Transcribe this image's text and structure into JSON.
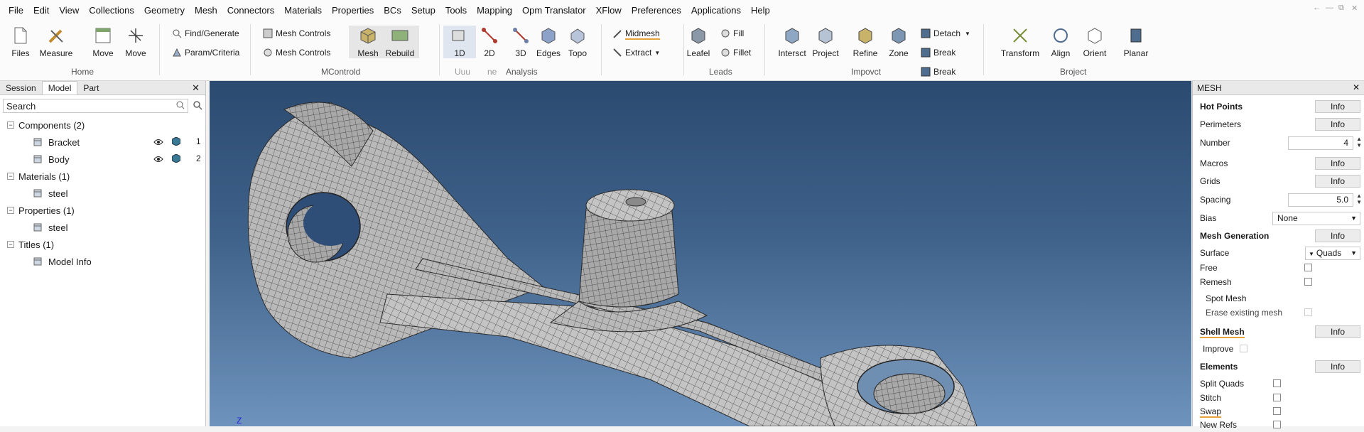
{
  "menu": [
    "File",
    "Edit",
    "View",
    "Collections",
    "Geometry",
    "Mesh",
    "Connectors",
    "Materials",
    "Properties",
    "BCs",
    "Setup",
    "Tools",
    "Mapping",
    "Opm Translator",
    "XFlow",
    "Preferences",
    "Applications",
    "Help"
  ],
  "window_controls": [
    "←",
    "—",
    "⧉",
    "✕"
  ],
  "ribbon": {
    "files": "Files",
    "measure": "Measure",
    "move1": "Move",
    "move2": "Move",
    "find_generate": "Find/Generate",
    "param_criteria": "Param/Criteria",
    "home_group": "Home",
    "mesh_controls1": "Mesh Controls",
    "mesh_controls2": "Mesh Controls",
    "mesh": "Mesh",
    "rebuild": "Rebuild",
    "mcontrol_group": "MControld",
    "b1d": "1D",
    "b2d": "2D",
    "b3d": "3D",
    "edges": "Edges",
    "topo": "Topo",
    "uuu": "Uuu",
    "ne": "ne",
    "analysis_group": "Analysis",
    "midmesh": "Midmesh",
    "extract": "Extract",
    "leafel": "Leafel",
    "fill": "Fill",
    "fillet": "Fillet",
    "leads_group": "Leads",
    "intersect": "Intersct",
    "project": "Project",
    "refine": "Refine",
    "zone": "Zone",
    "detach": "Detach",
    "break1": "Break",
    "break2": "Break",
    "improve_group": "Impovct",
    "transform": "Transform",
    "align": "Align",
    "orient": "Orient",
    "planar": "Planar",
    "project_group": "Broject"
  },
  "left_panel": {
    "tabs": [
      "Session",
      "Model",
      "Part"
    ],
    "active_tab": "Model",
    "close": "✕",
    "search_placeholder": "Search",
    "tree": [
      {
        "label": "Components (2)",
        "level": 0
      },
      {
        "label": "Bracket",
        "level": 1,
        "num": "1",
        "visible": true
      },
      {
        "label": "Body",
        "level": 1,
        "num": "2",
        "visible": true
      },
      {
        "label": "Materials (1)",
        "level": 0
      },
      {
        "label": "steel",
        "level": 1
      },
      {
        "label": "Properties (1)",
        "level": 0
      },
      {
        "label": "steel",
        "level": 1
      },
      {
        "label": "Titles (1)",
        "level": 0
      },
      {
        "label": "Model Info",
        "level": 1
      }
    ]
  },
  "viewport": {
    "axis_label": "Z"
  },
  "right_panel": {
    "title": "MESH",
    "close": "✕",
    "hot_points": "Hot Points",
    "info": "Info",
    "perimeters": "Perimeters",
    "number": "Number",
    "number_value": "4",
    "macros": "Macros",
    "grids": "Grids",
    "spacing": "Spacing",
    "spacing_value": "5.0",
    "bias": "Bias",
    "bias_value": "None",
    "mesh_generation": "Mesh Generation",
    "surface": "Surface",
    "surface_value": "Quads",
    "free": "Free",
    "remesh": "Remesh",
    "spot_mesh": "Spot Mesh",
    "erase_existing": "Erase existing mesh",
    "shell_mesh": "Shell Mesh",
    "improve": "Improve",
    "elements": "Elements",
    "split_quads": "Split Quads",
    "stitch": "Stitch",
    "swap": "Swap",
    "new_refs": "New Refs"
  },
  "colors": {
    "accent": "#e8a23c",
    "viewport_top": "#2b4a70",
    "viewport_bottom": "#6e93bc",
    "mesh_gray": "#b8b8b8"
  }
}
